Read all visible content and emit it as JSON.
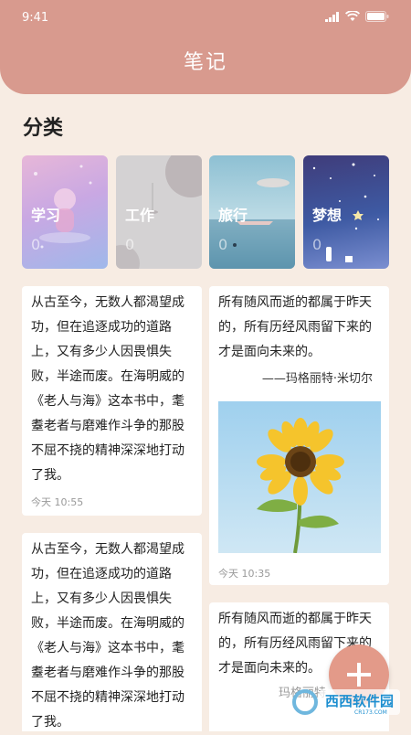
{
  "status": {
    "time": "9:41"
  },
  "header": {
    "title": "笔记"
  },
  "section": {
    "title": "分类"
  },
  "categories": [
    {
      "label": "学习",
      "count": "0"
    },
    {
      "label": "工作",
      "count": "0"
    },
    {
      "label": "旅行",
      "count": "0"
    },
    {
      "label": "梦想",
      "count": "0"
    }
  ],
  "notes_left": [
    {
      "text": "从古至今，无数人都渴望成功，但在追逐成功的道路上，又有多少人因畏惧失败，半途而废。在海明威的《老人与海》这本书中，耄耋老者与磨难作斗争的那股不屈不挠的精神深深地打动了我。",
      "time": "今天 10:55"
    },
    {
      "text": "从古至今，无数人都渴望成功，但在追逐成功的道路上，又有多少人因畏惧失败，半途而废。在海明威的《老人与海》这本书中，耄耋老者与磨难作斗争的那股不屈不挠的精神深深地打动了我。"
    }
  ],
  "notes_right": [
    {
      "text": "所有随风而逝的都属于昨天的，所有历经风雨留下来的才是面向未来的。",
      "author": "——玛格丽特·米切尔",
      "image": "sunflower",
      "time": "今天 10:35"
    },
    {
      "text": "所有随风而逝的都属于昨天的，所有历经风雨留下来的才是面向未来的。",
      "author": "玛格丽特"
    }
  ],
  "fab": {
    "icon": "plus-icon"
  },
  "watermark": {
    "text": "西西软件园",
    "site": "CR173.COM"
  },
  "colors": {
    "header": "#d89a8e",
    "background": "#f7ece3",
    "fab": "#e39a89"
  }
}
